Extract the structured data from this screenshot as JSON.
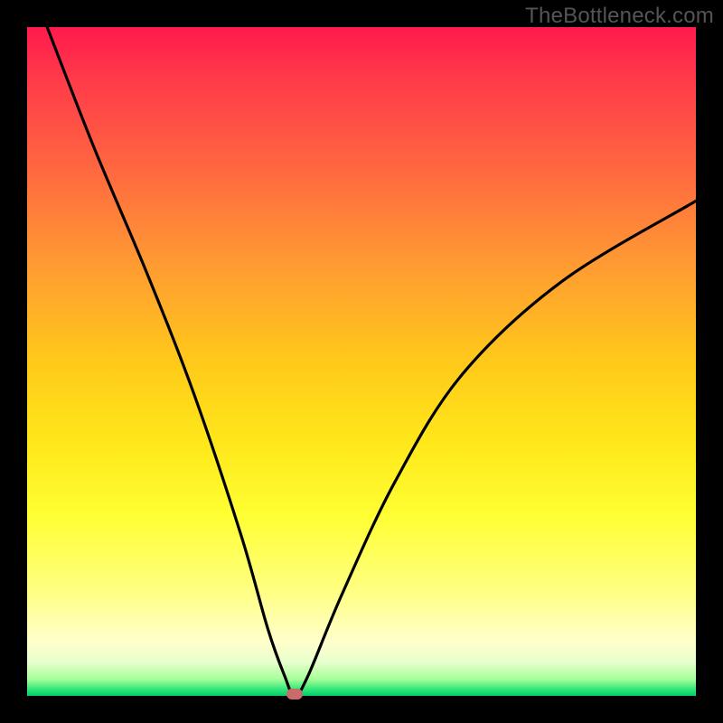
{
  "watermark": "TheBottleneck.com",
  "chart_data": {
    "type": "line",
    "title": "",
    "xlabel": "",
    "ylabel": "",
    "xlim": [
      0,
      100
    ],
    "ylim": [
      0,
      100
    ],
    "series": [
      {
        "name": "bottleneck-curve",
        "x": [
          3,
          10,
          18,
          25,
          32,
          36,
          38.5,
          40,
          42,
          47,
          55,
          65,
          80,
          100
        ],
        "values": [
          100,
          82,
          63,
          45,
          24,
          10,
          3,
          0,
          3,
          15,
          32,
          48,
          62,
          74
        ]
      }
    ],
    "optimal_point": {
      "x": 40,
      "y": 0
    },
    "annotations": [],
    "legend": null
  },
  "colors": {
    "background_top": "#ff1a4d",
    "background_bottom": "#00cc66",
    "curve": "#000000",
    "marker": "#c76b6b",
    "frame": "#000000"
  }
}
